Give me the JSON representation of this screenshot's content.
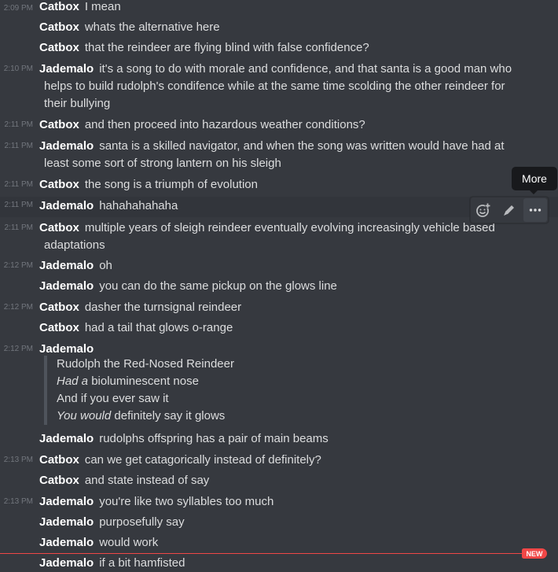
{
  "messages": [
    {
      "ts": "2:09 PM",
      "author": "Catbox",
      "text": "I mean"
    },
    {
      "author": "Catbox",
      "text": "whats the alternative here"
    },
    {
      "author": "Catbox",
      "text": "that the reindeer are flying blind with false confidence?"
    },
    {
      "ts": "2:10 PM",
      "author": "Jademalo",
      "text": "it's a song to do with morale and confidence, and that santa is a good man who",
      "cont": [
        "helps to build rudolph's condifence while at the same time scolding the other reindeer for",
        "their bullying"
      ]
    },
    {
      "ts": "2:11 PM",
      "author": "Catbox",
      "text": "and then proceed into hazardous weather conditions?"
    },
    {
      "ts": "2:11 PM",
      "author": "Jademalo",
      "text": "santa is a skilled navigator, and when the song was written would have had at",
      "cont": [
        "least some sort of strong lantern on his sleigh"
      ]
    },
    {
      "ts": "2:11 PM",
      "author": "Catbox",
      "text": "the song is a triumph of evolution"
    },
    {
      "ts": "2:11 PM",
      "author": "Jademalo",
      "text": "hahahahahaha"
    },
    {
      "ts": "2:11 PM",
      "author": "Catbox",
      "text": "multiple years of sleigh reindeer eventually evolving increasingly vehicle based",
      "cont": [
        "adaptations"
      ]
    },
    {
      "ts": "2:12 PM",
      "author": "Jademalo",
      "text": "oh"
    },
    {
      "author": "Jademalo",
      "text": "you can do the same pickup on the glows line"
    },
    {
      "ts": "2:12 PM",
      "author": "Catbox",
      "text": "dasher the turnsignal reindeer"
    },
    {
      "author": "Catbox",
      "text": "had a tail that glows o-range"
    },
    {
      "ts": "2:12 PM",
      "author": "Jademalo",
      "text": ""
    },
    {
      "author": "Jademalo",
      "text": "rudolphs offspring has a pair of main beams"
    },
    {
      "ts": "2:13 PM",
      "author": "Catbox",
      "text": "can we get catagorically instead of definitely?"
    },
    {
      "author": "Catbox",
      "text": "and state instead of say"
    },
    {
      "ts": "2:13 PM",
      "author": "Jademalo",
      "text": "you're like two syllables too much"
    },
    {
      "author": "Jademalo",
      "text": "purposefully say"
    },
    {
      "author": "Jademalo",
      "text": "would work"
    },
    {
      "author": "Jademalo",
      "text": "if a bit hamfisted"
    }
  ],
  "quote": {
    "line1": "Rudolph the Red-Nosed Reindeer",
    "line2_em": "Had a",
    "line2_rest": " bioluminescent nose",
    "line3": "And if you ever saw it",
    "line4_em": "You would",
    "line4_rest": " definitely say it glows"
  },
  "toolbar": {
    "tooltip": "More",
    "icons": [
      "add-reaction-icon",
      "edit-pencil-icon",
      "more-dots-icon"
    ]
  },
  "new_badge": "NEW",
  "colors": {
    "background": "#36393f",
    "hover_row": "#32353b",
    "author": "#ffffff",
    "text": "#dcddde",
    "timestamp": "#72767d",
    "new_marker": "#f04747"
  }
}
